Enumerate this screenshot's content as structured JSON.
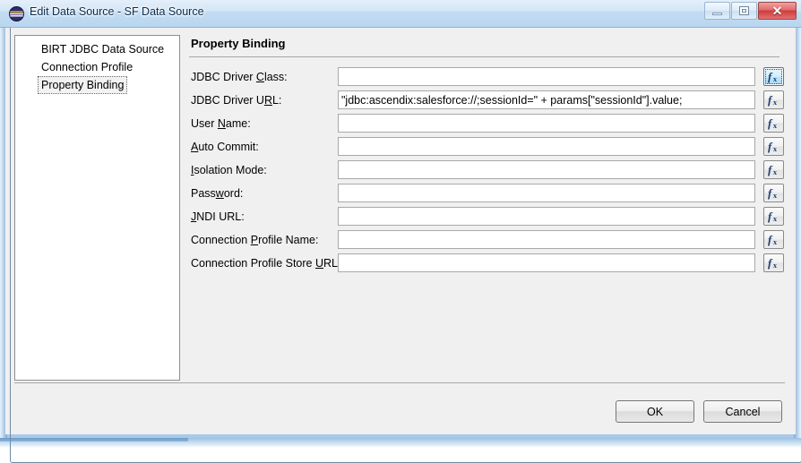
{
  "window": {
    "title": "Edit Data Source - SF Data Source",
    "icon": "birt-data-source-icon",
    "controls": {
      "minimize_label": "Minimize",
      "maximize_label": "Restore",
      "close_label": "Close",
      "close_glyph": "✕"
    }
  },
  "sidebar": {
    "items": [
      {
        "label": "BIRT JDBC Data Source",
        "selected": false
      },
      {
        "label": "Connection Profile",
        "selected": false
      },
      {
        "label": "Property Binding",
        "selected": true
      }
    ]
  },
  "main": {
    "page_title": "Property Binding",
    "fields": [
      {
        "label_pre": "JDBC Driver ",
        "label_key": "C",
        "label_post": "lass:",
        "value": "",
        "placeholder": "",
        "fx_label": "fx",
        "fx_focused": true
      },
      {
        "label_pre": "JDBC Driver U",
        "label_key": "R",
        "label_post": "L:",
        "value": "\"jdbc:ascendix:salesforce://;sessionId=\" + params[\"sessionId\"].value;",
        "placeholder": "",
        "fx_label": "fx",
        "fx_focused": false
      },
      {
        "label_pre": "User ",
        "label_key": "N",
        "label_post": "ame:",
        "value": "",
        "placeholder": "",
        "fx_label": "fx",
        "fx_focused": false
      },
      {
        "label_pre": "",
        "label_key": "A",
        "label_post": "uto Commit:",
        "value": "",
        "placeholder": "",
        "fx_label": "fx",
        "fx_focused": false
      },
      {
        "label_pre": "",
        "label_key": "I",
        "label_post": "solation Mode:",
        "value": "",
        "placeholder": "",
        "fx_label": "fx",
        "fx_focused": false
      },
      {
        "label_pre": "Pass",
        "label_key": "w",
        "label_post": "ord:",
        "value": "",
        "placeholder": "",
        "fx_label": "fx",
        "fx_focused": false
      },
      {
        "label_pre": "",
        "label_key": "J",
        "label_post": "NDI URL:",
        "value": "",
        "placeholder": "",
        "fx_label": "fx",
        "fx_focused": false
      },
      {
        "label_pre": "Connection ",
        "label_key": "P",
        "label_post": "rofile Name:",
        "value": "",
        "placeholder": "",
        "fx_label": "fx",
        "fx_focused": false
      },
      {
        "label_pre": "Connection Profile Store ",
        "label_key": "U",
        "label_post": "RL:",
        "value": "",
        "placeholder": "",
        "fx_label": "fx",
        "fx_focused": false
      }
    ]
  },
  "footer": {
    "ok_label": "OK",
    "cancel_label": "Cancel"
  },
  "colors": {
    "titlebar_accent": "#b8d6f0",
    "close_button": "#cf3c3c",
    "focus_blue": "#3c7fb1",
    "fx_glyph": "#1f3f73",
    "dialog_background": "#f0f0f0",
    "field_background": "#ffffff",
    "field_border": "#a9a9a9"
  }
}
